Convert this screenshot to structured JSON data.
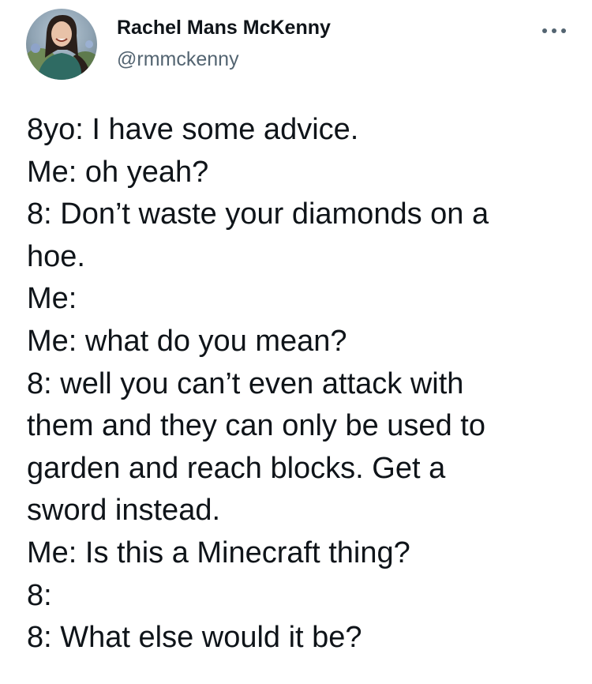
{
  "author": {
    "display_name": "Rachel Mans McKenny",
    "handle": "@rmmckenny"
  },
  "icons": {
    "avatar": "profile-photo",
    "more": "more-options-icon"
  },
  "tweet": {
    "lines": [
      "8yo: I have some advice.",
      "Me: oh yeah?",
      "8: Don’t waste your diamonds on a",
      "hoe.",
      "Me:",
      "Me: what do you mean?",
      "8: well you can’t even attack with",
      "them and they can only be used to",
      "garden and reach blocks. Get a",
      "sword instead.",
      "Me: Is this a Minecraft thing?",
      "8:",
      "8: What else would it be?"
    ]
  },
  "colors": {
    "text_primary": "#0f1419",
    "text_secondary": "#536471"
  }
}
